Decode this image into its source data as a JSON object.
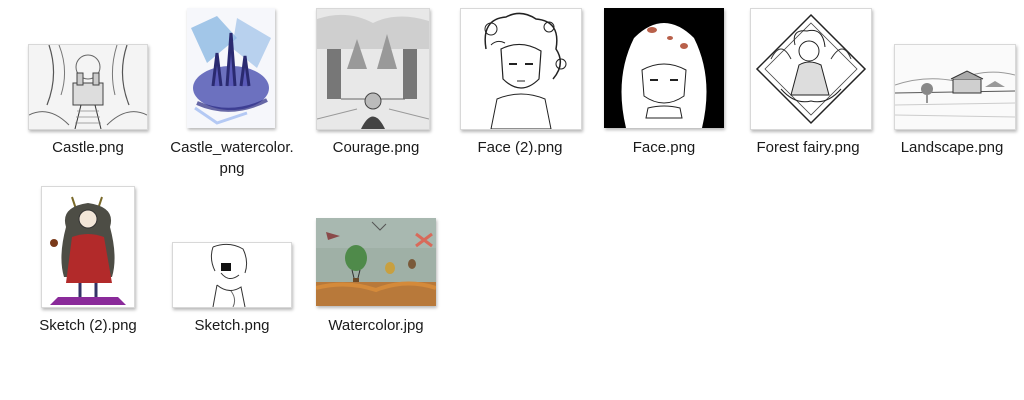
{
  "files": [
    {
      "name": "Castle.png",
      "thumbnail": "pencil-sketch-girl-with-castle"
    },
    {
      "name": "Castle_watercolor.png",
      "thumbnail": "blue-watercolor-castle"
    },
    {
      "name": "Courage.png",
      "thumbnail": "grey-sketch-gate-and-castle"
    },
    {
      "name": "Face (2).png",
      "thumbnail": "ink-portrait-curly-hair"
    },
    {
      "name": "Face.png",
      "thumbnail": "face-on-black-background"
    },
    {
      "name": "Forest fairy.png",
      "thumbnail": "ink-fairy-in-diamond-frame"
    },
    {
      "name": "Landscape.png",
      "thumbnail": "pencil-landscape-with-houses"
    },
    {
      "name": "Sketch (2).png",
      "thumbnail": "horned-girl-in-red-cloak"
    },
    {
      "name": "Sketch.png",
      "thumbnail": "line-sketch-girl-face"
    },
    {
      "name": "Watercolor.jpg",
      "thumbnail": "hot-air-balloons-watercolor"
    }
  ]
}
